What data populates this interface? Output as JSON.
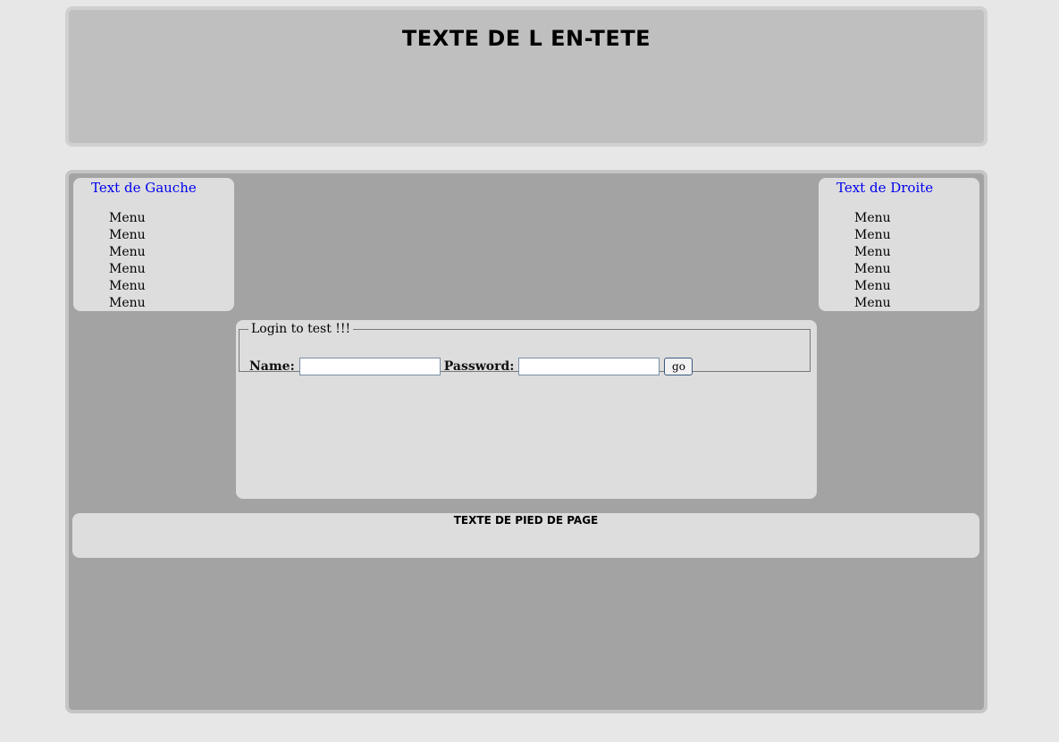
{
  "header": {
    "title": "TEXTE DE L EN-TETE"
  },
  "sidebar_left": {
    "title": "Text de Gauche",
    "items": [
      "Menu",
      "Menu",
      "Menu",
      "Menu",
      "Menu",
      "Menu"
    ]
  },
  "sidebar_right": {
    "title": "Text de Droite",
    "items": [
      "Menu",
      "Menu",
      "Menu",
      "Menu",
      "Menu",
      "Menu"
    ]
  },
  "login": {
    "legend": "Login to test !!!",
    "name_label": "Name:",
    "name_value": "",
    "password_label": "Password:",
    "password_value": "",
    "submit_label": "go"
  },
  "footer": {
    "text": "TEXTE DE PIED DE PAGE"
  },
  "colors": {
    "page_bg": "#e6e7e6",
    "header_bg": "#bfbfbf",
    "container_bg": "#a2a3a2",
    "panel_bg": "#dcdddc",
    "sidebar_title": "#0000ee"
  }
}
